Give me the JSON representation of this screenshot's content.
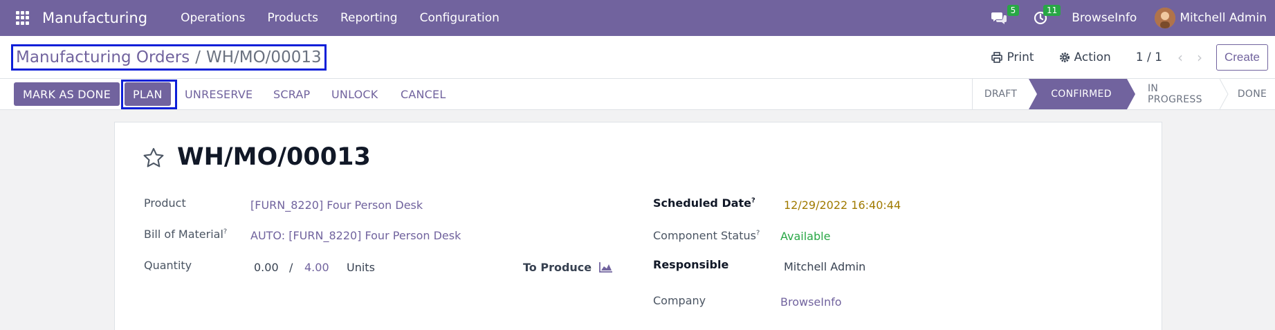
{
  "navbar": {
    "app_name": "Manufacturing",
    "menu": [
      "Operations",
      "Products",
      "Reporting",
      "Configuration"
    ],
    "messages_count": "5",
    "activities_count": "11",
    "company": "BrowseInfo",
    "user": "Mitchell Admin"
  },
  "control_panel": {
    "breadcrumb_parent": "Manufacturing Orders",
    "breadcrumb_separator": "/",
    "breadcrumb_current": "WH/MO/00013",
    "print_label": "Print",
    "action_label": "Action",
    "pager": "1 / 1",
    "create_label": "Create"
  },
  "statusbar": {
    "buttons": [
      "MARK AS DONE",
      "PLAN",
      "UNRESERVE",
      "SCRAP",
      "UNLOCK",
      "CANCEL"
    ],
    "stages": [
      "DRAFT",
      "CONFIRMED",
      "IN PROGRESS",
      "DONE"
    ],
    "active_stage": "CONFIRMED"
  },
  "form": {
    "title": "WH/MO/00013",
    "product_label": "Product",
    "product_value": "[FURN_8220] Four Person Desk",
    "bom_label": "Bill of Material",
    "bom_value": "AUTO: [FURN_8220] Four Person Desk",
    "quantity_label": "Quantity",
    "quantity_produced": "0.00",
    "quantity_separator": "/",
    "quantity_total": "4.00",
    "quantity_uom": "Units",
    "to_produce_label": "To Produce",
    "scheduled_date_label": "Scheduled Date",
    "scheduled_date_value": "12/29/2022 16:40:44",
    "component_status_label": "Component Status",
    "component_status_value": "Available",
    "responsible_label": "Responsible",
    "responsible_value": "Mitchell Admin",
    "company_label": "Company",
    "company_value": "BrowseInfo",
    "help_mark": "?"
  },
  "colors": {
    "brand": "#71639e",
    "highlight": "#0d1fd8",
    "badge": "#28a745",
    "date": "#a07a00",
    "available": "#28a745"
  }
}
